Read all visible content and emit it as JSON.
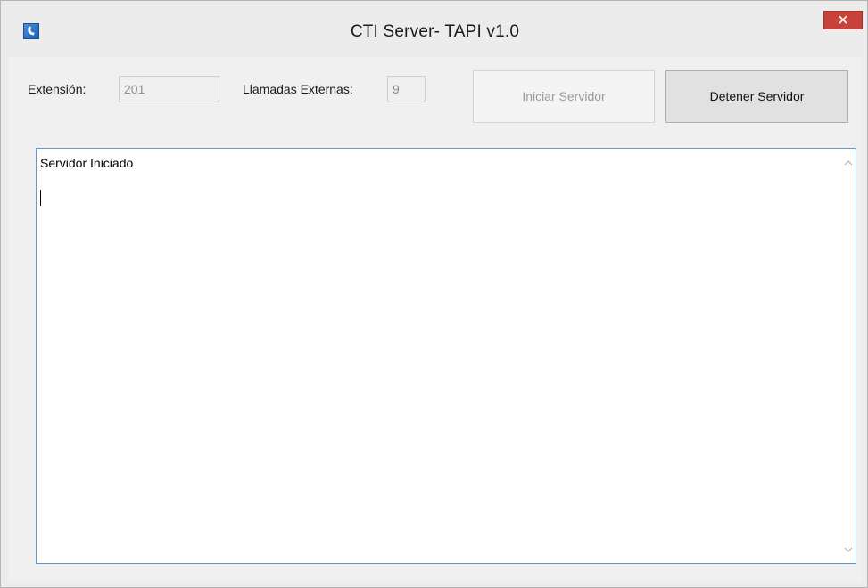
{
  "window": {
    "title": "CTI Server- TAPI  v1.0",
    "close_label": "✕"
  },
  "form": {
    "extension_label": "Extensión:",
    "extension_value": "201",
    "external_calls_label": "Llamadas Externas:",
    "external_calls_value": "9",
    "start_button": "Iniciar Servidor",
    "stop_button": "Detener Servidor"
  },
  "log": {
    "text": "Servidor Iniciado"
  },
  "icons": {
    "app": "phone-icon",
    "scroll_up": "chevron-up-icon",
    "scroll_down": "chevron-down-icon"
  },
  "colors": {
    "close_button": "#c7423a",
    "log_border": "#5b9bd5",
    "app_icon": "#1b5fb4"
  }
}
